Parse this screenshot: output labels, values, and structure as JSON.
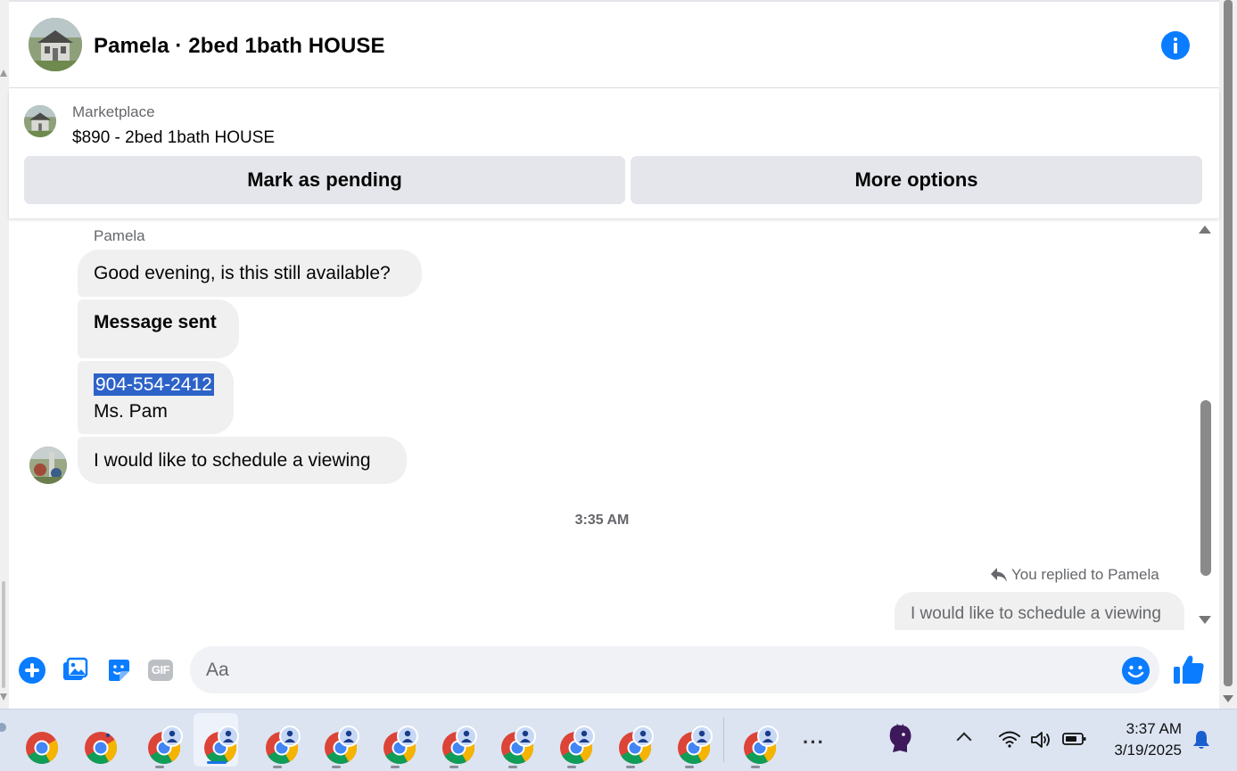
{
  "header": {
    "title": "Pamela · 2bed 1bath HOUSE"
  },
  "listing": {
    "label": "Marketplace",
    "title": "$890 - 2bed 1bath HOUSE",
    "mark_pending_label": "Mark as pending",
    "more_options_label": "More options"
  },
  "messages": {
    "sender_name": "Pamela",
    "items": [
      {
        "text": "Good evening, is this still available?"
      },
      {
        "text": "Message sent"
      },
      {
        "phone": "904-554-2412",
        "signature": "Ms. Pam"
      },
      {
        "text": "I would like to schedule a viewing"
      }
    ],
    "timestamp": "3:35 AM",
    "reply_note": "You replied to Pamela",
    "reply_quote": "I would like to schedule a viewing"
  },
  "composer": {
    "placeholder": "Aa",
    "gif_label": "GIF"
  },
  "taskbar": {
    "time": "3:37 AM",
    "date": "3/19/2025",
    "more": "···"
  },
  "colors": {
    "accent": "#0a7cff",
    "bubble": "#f0f0f0",
    "button": "#e4e6eb",
    "selection": "#2d63c8"
  }
}
